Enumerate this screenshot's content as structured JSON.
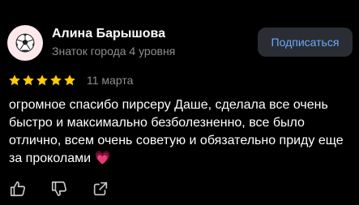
{
  "review": {
    "author": {
      "name": "Алина Барышова",
      "level": "Знаток города 4 уровня",
      "avatar_icon": "soccer-ball-icon"
    },
    "subscribe_label": "Подписаться",
    "rating": 5,
    "rating_max": 5,
    "date": "11 марта",
    "text": "огромное спасибо пирсеру Даше, сделала все очень быстро и максимально безболезненно, все было отлично, всем очень советую и обязательно приду еще за проколами 💗",
    "actions": [
      "like-icon",
      "dislike-icon",
      "share-icon"
    ]
  },
  "colors": {
    "background": "#000000",
    "star": "#ffcc00",
    "accent": "#6aa9ff",
    "secondary_text": "#8e8e93",
    "button_bg": "#2a2d33"
  }
}
